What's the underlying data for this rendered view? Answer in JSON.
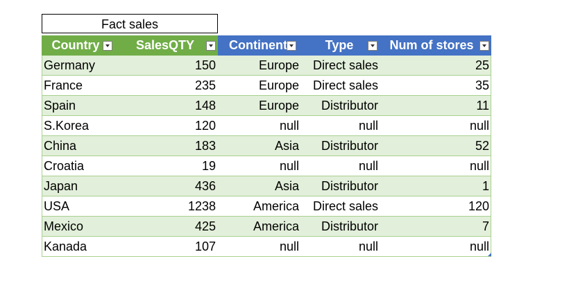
{
  "title": "Fact sales",
  "columns": [
    {
      "label": "Country",
      "align": "left",
      "color": "#70ad47"
    },
    {
      "label": "SalesQTY",
      "align": "right",
      "color": "#70ad47"
    },
    {
      "label": "Continent",
      "align": "right",
      "color": "#4472c4"
    },
    {
      "label": "Type",
      "align": "right",
      "color": "#4472c4"
    },
    {
      "label": "Num of stores",
      "align": "right",
      "color": "#4472c4"
    }
  ],
  "rows": [
    [
      "Germany",
      "150",
      "Europe",
      "Direct sales",
      "25"
    ],
    [
      "France",
      "235",
      "Europe",
      "Direct sales",
      "35"
    ],
    [
      "Spain",
      "148",
      "Europe",
      "Distributor",
      "11"
    ],
    [
      "S.Korea",
      "120",
      "null",
      "null",
      "null"
    ],
    [
      "China",
      "183",
      "Asia",
      "Distributor",
      "52"
    ],
    [
      "Croatia",
      "19",
      "null",
      "null",
      "null"
    ],
    [
      "Japan",
      "436",
      "Asia",
      "Distributor",
      "1"
    ],
    [
      "USA",
      "1238",
      "America",
      "Direct sales",
      "120"
    ],
    [
      "Mexico",
      "425",
      "America",
      "Distributor",
      "7"
    ],
    [
      "Kanada",
      "107",
      "null",
      "null",
      "null"
    ]
  ],
  "colors": {
    "header_green": "#70ad47",
    "header_blue": "#4472c4",
    "band_light": "#e2efda",
    "border": "#a9d08e"
  },
  "icons": {
    "filter_dropdown": "filter-dropdown-icon"
  }
}
